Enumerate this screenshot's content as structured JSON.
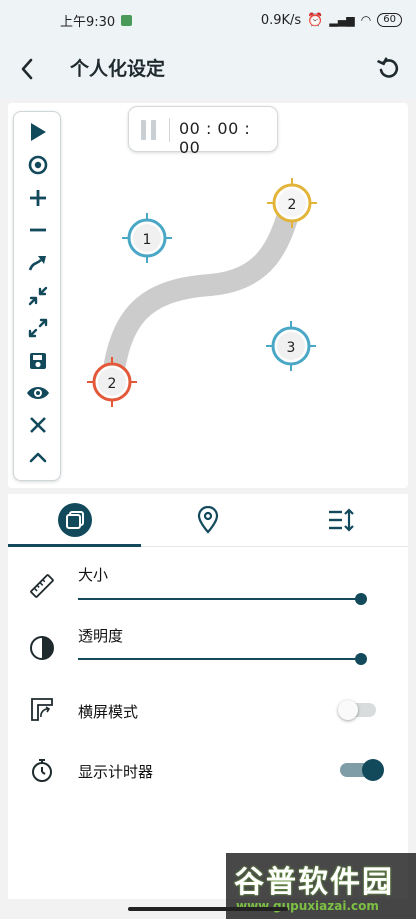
{
  "status_bar": {
    "time": "上午9:30",
    "speed": "0.9K/s",
    "network": "4G",
    "battery": "60"
  },
  "app_bar": {
    "title": "个人化设定"
  },
  "preview": {
    "timer": "00 : 00 : 00",
    "targets": [
      {
        "label": "1",
        "color": "#4aa8c6"
      },
      {
        "label": "2",
        "color": "#e2b43a"
      },
      {
        "label": "3",
        "color": "#4aa8c6"
      },
      {
        "label": "2",
        "color": "#e4583a"
      }
    ],
    "toolbar": [
      {
        "name": "play-icon"
      },
      {
        "name": "target-icon"
      },
      {
        "name": "plus-icon"
      },
      {
        "name": "minus-icon"
      },
      {
        "name": "curve-arrow-icon"
      },
      {
        "name": "shrink-icon"
      },
      {
        "name": "expand-icon"
      },
      {
        "name": "save-icon"
      },
      {
        "name": "eye-icon"
      },
      {
        "name": "close-icon"
      },
      {
        "name": "chevron-up-icon"
      }
    ]
  },
  "tabs": [
    {
      "name": "copy-icon",
      "active": true
    },
    {
      "name": "location-pin-icon",
      "active": false
    },
    {
      "name": "sort-list-icon",
      "active": false
    }
  ],
  "settings": {
    "size": {
      "label": "大小",
      "value": 1.0
    },
    "opacity": {
      "label": "透明度",
      "value": 1.0
    },
    "landscape": {
      "label": "横屏模式",
      "enabled": false
    },
    "show_timer": {
      "label": "显示计时器",
      "enabled": true
    }
  },
  "watermark": {
    "title": "谷普软件园",
    "url": "www.gupuxiazai.com"
  },
  "colors": {
    "primary": "#124a5c",
    "target_blue": "#4aa8c6",
    "target_yellow": "#e2b43a",
    "target_orange": "#e4583a",
    "path_gray": "#cccccc"
  }
}
